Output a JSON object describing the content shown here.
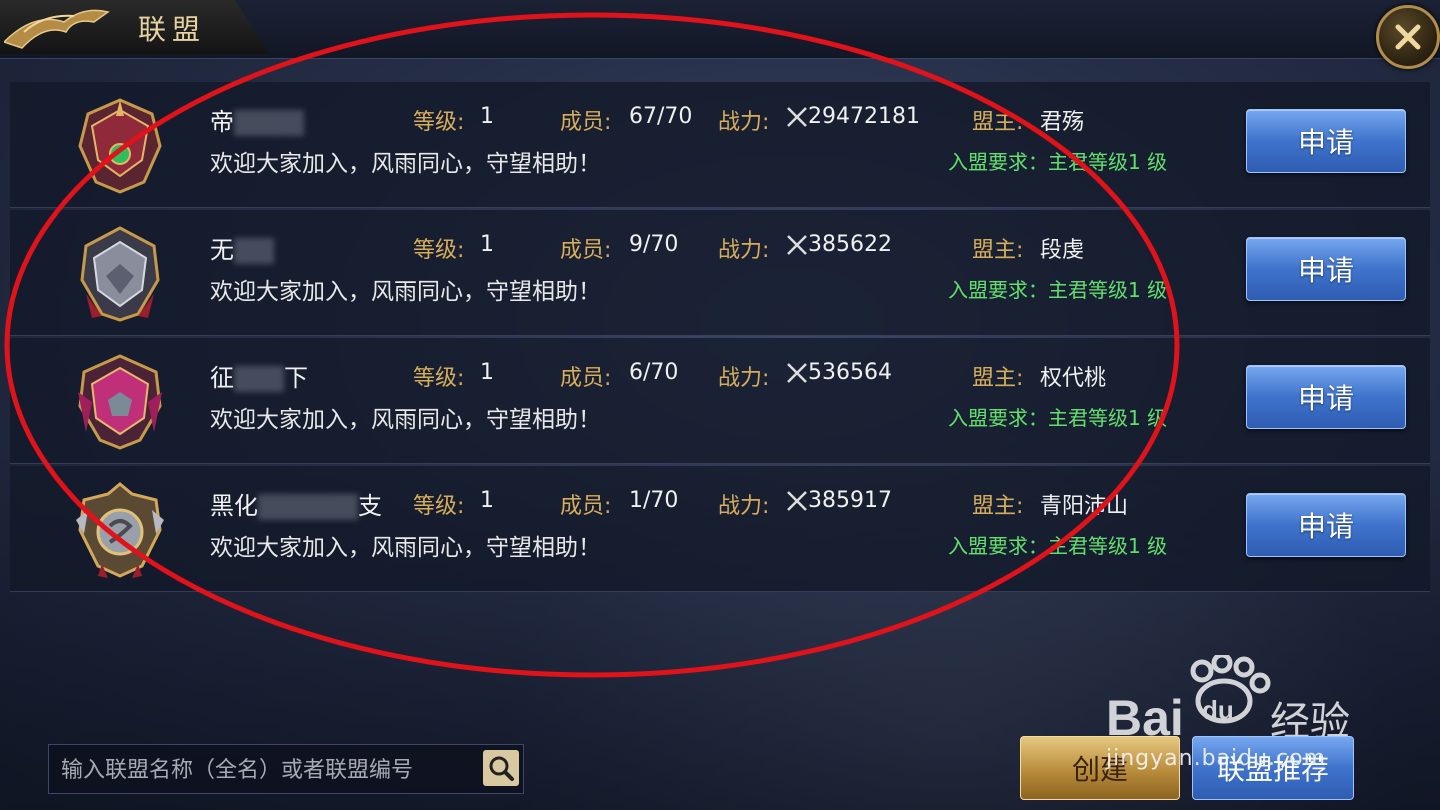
{
  "header": {
    "title": "联盟"
  },
  "colors": {
    "gold": "#d6ae5b",
    "green": "#5fe06e",
    "blue_button": "#3f73cc",
    "annotation_red": "#e0121a"
  },
  "labels": {
    "level": "等级:",
    "members": "成员:",
    "power": "战力:",
    "leader": "盟主:",
    "apply": "申请"
  },
  "alliances": [
    {
      "name": "帝",
      "level": "1",
      "members": "67/70",
      "power": "29472181",
      "leader": "君殇",
      "desc": "欢迎大家加入，风雨同心，守望相助！",
      "requirement": "入盟要求：主君等级1 级",
      "emblem": "dragon-crest-red"
    },
    {
      "name": "无",
      "level": "1",
      "members": "9/70",
      "power": "385622",
      "leader": "段虔",
      "desc": "欢迎大家加入，风雨同心，守望相助！",
      "requirement": "入盟要求：主君等级1 级",
      "emblem": "beast-crest-silver"
    },
    {
      "name": "下",
      "name_prefix": "征",
      "level": "1",
      "members": "6/70",
      "power": "536564",
      "leader": "权代桃",
      "desc": "欢迎大家加入，风雨同心，守望相助！",
      "requirement": "入盟要求：主君等级1 级",
      "emblem": "lion-crest-magenta"
    },
    {
      "name": "黑化",
      "name_suffix": "支",
      "level": "1",
      "members": "1/70",
      "power": "385917",
      "leader": "青阳沛山",
      "desc": "欢迎大家加入，风雨同心，守望相助！",
      "requirement": "入盟要求：主君等级1 级",
      "emblem": "axe-crest-gold"
    }
  ],
  "search": {
    "placeholder": "输入联盟名称（全名）或者联盟编号"
  },
  "buttons": {
    "create": "创建",
    "recommend": "联盟推荐"
  },
  "watermark": {
    "text": "jingyan.baidu.com",
    "logo": "Baidu经验"
  }
}
